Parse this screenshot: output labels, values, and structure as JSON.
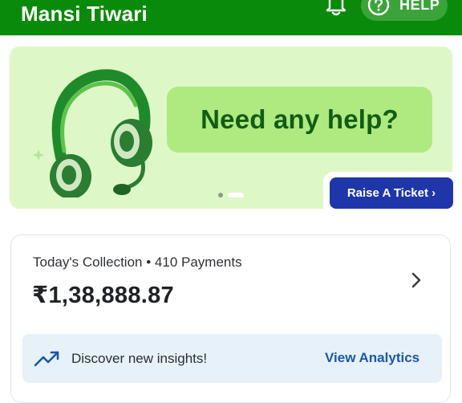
{
  "header": {
    "title": "Mansi Tiwari",
    "bell_icon": "bell-icon",
    "help_icon": "question-circle-icon",
    "help_label": "HELP"
  },
  "banner": {
    "message": "Need any help?",
    "illustration": "headset-icon",
    "active_slide": 1,
    "slide_count": 2
  },
  "ticket_button": {
    "label": "Raise A Ticket",
    "chevron": "›"
  },
  "collection": {
    "label": "Today's Collection",
    "separator": "•",
    "payments": "410 Payments",
    "amount": "₹1,38,888.87",
    "chevron_icon": "chevron-right-icon"
  },
  "insights": {
    "icon": "trending-up-icon",
    "text": "Discover new insights!",
    "link": "View Analytics"
  },
  "colors": {
    "header_green": "#0a8a0a",
    "banner_bg": "#ddf8c6",
    "bubble_bg": "#aeea80",
    "bubble_text": "#125c14",
    "ticket_blue": "#1f36a9",
    "insights_bg": "#e6f1fa",
    "link_blue": "#1d56a8"
  }
}
